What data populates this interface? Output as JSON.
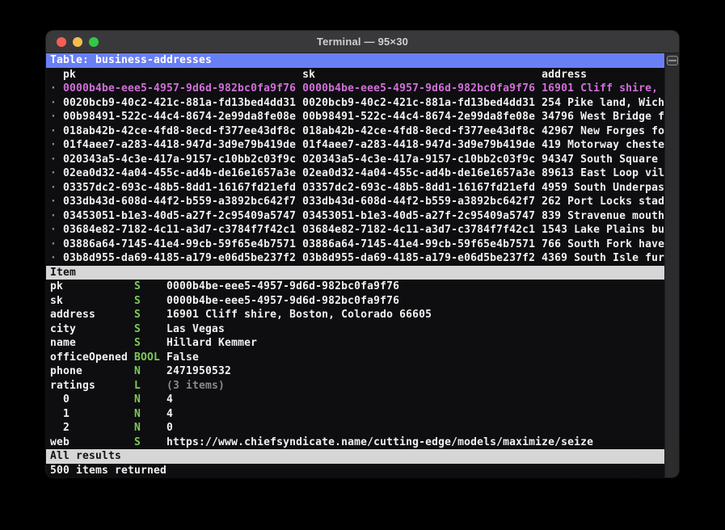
{
  "window": {
    "title": "Terminal — 95×30"
  },
  "colors": {
    "accent_blue": "#6980f5",
    "selected_magenta": "#d06fd8",
    "type_green": "#7ccb54",
    "bar_gray": "#d6d6d6",
    "term_bg": "#0e0e10",
    "titlebar_bg": "#39393b",
    "fg": "#f1f1f1",
    "dim": "#8a8a8a",
    "bullet": "#8f8f8f",
    "scroll_bg": "#2c2c2e",
    "tl_red": "#f35f56",
    "tl_yellow": "#f5bd4f",
    "tl_green": "#33c748"
  },
  "table": {
    "title": "Table: business-addresses",
    "columns": [
      "pk",
      "sk",
      "address"
    ],
    "rows": [
      {
        "pk": "0000b4be-eee5-4957-9d6d-982bc0fa9f76",
        "sk": "0000b4be-eee5-4957-9d6d-982bc0fa9f76",
        "address": "16901 Cliff shire,",
        "selected": true
      },
      {
        "pk": "0020bcb9-40c2-421c-881a-fd13bed4dd31",
        "sk": "0020bcb9-40c2-421c-881a-fd13bed4dd31",
        "address": "254 Pike land, Wich",
        "selected": false
      },
      {
        "pk": "00b98491-522c-44c4-8674-2e99da8fe08e",
        "sk": "00b98491-522c-44c4-8674-2e99da8fe08e",
        "address": "34796 West Bridge f",
        "selected": false
      },
      {
        "pk": "018ab42b-42ce-4fd8-8ecd-f377ee43df8c",
        "sk": "018ab42b-42ce-4fd8-8ecd-f377ee43df8c",
        "address": "42967 New Forges fo",
        "selected": false
      },
      {
        "pk": "01f4aee7-a283-4418-947d-3d9e79b419de",
        "sk": "01f4aee7-a283-4418-947d-3d9e79b419de",
        "address": "419 Motorway cheste",
        "selected": false
      },
      {
        "pk": "020343a5-4c3e-417a-9157-c10bb2c03f9c",
        "sk": "020343a5-4c3e-417a-9157-c10bb2c03f9c",
        "address": "94347 South Square",
        "selected": false
      },
      {
        "pk": "02ea0d32-4a04-455c-ad4b-de16e1657a3e",
        "sk": "02ea0d32-4a04-455c-ad4b-de16e1657a3e",
        "address": "89613 East Loop vil",
        "selected": false
      },
      {
        "pk": "03357dc2-693c-48b5-8dd1-16167fd21efd",
        "sk": "03357dc2-693c-48b5-8dd1-16167fd21efd",
        "address": "4959 South Underpas",
        "selected": false
      },
      {
        "pk": "033db43d-608d-44f2-b559-a3892bc642f7",
        "sk": "033db43d-608d-44f2-b559-a3892bc642f7",
        "address": "262 Port Locks stad",
        "selected": false
      },
      {
        "pk": "03453051-b1e3-40d5-a27f-2c95409a5747",
        "sk": "03453051-b1e3-40d5-a27f-2c95409a5747",
        "address": "839 Stravenue mouth",
        "selected": false
      },
      {
        "pk": "03684e82-7182-4c11-a3d7-c3784f7f42c1",
        "sk": "03684e82-7182-4c11-a3d7-c3784f7f42c1",
        "address": "1543 Lake Plains bu",
        "selected": false
      },
      {
        "pk": "03886a64-7145-41e4-99cb-59f65e4b7571",
        "sk": "03886a64-7145-41e4-99cb-59f65e4b7571",
        "address": "766 South Fork have",
        "selected": false
      },
      {
        "pk": "03b8d955-da69-4185-a179-e06d5be237f2",
        "sk": "03b8d955-da69-4185-a179-e06d5be237f2",
        "address": "4369 South Isle fur",
        "selected": false
      }
    ]
  },
  "item": {
    "header": "Item",
    "fields": [
      {
        "key": "pk",
        "type": "S",
        "value": "0000b4be-eee5-4957-9d6d-982bc0fa9f76",
        "dim": false
      },
      {
        "key": "sk",
        "type": "S",
        "value": "0000b4be-eee5-4957-9d6d-982bc0fa9f76",
        "dim": false
      },
      {
        "key": "address",
        "type": "S",
        "value": "16901 Cliff shire, Boston, Colorado 66605",
        "dim": false
      },
      {
        "key": "city",
        "type": "S",
        "value": "Las Vegas",
        "dim": false
      },
      {
        "key": "name",
        "type": "S",
        "value": "Hillard Kemmer",
        "dim": false
      },
      {
        "key": "officeOpened",
        "type": "BOOL",
        "value": "False",
        "dim": false
      },
      {
        "key": "phone",
        "type": "N",
        "value": "2471950532",
        "dim": false
      },
      {
        "key": "ratings",
        "type": "L",
        "value": "(3 items)",
        "dim": true
      },
      {
        "key": "  0",
        "type": "N",
        "value": "4",
        "dim": false
      },
      {
        "key": "  1",
        "type": "N",
        "value": "4",
        "dim": false
      },
      {
        "key": "  2",
        "type": "N",
        "value": "0",
        "dim": false
      },
      {
        "key": "web",
        "type": "S",
        "value": "https://www.chiefsyndicate.name/cutting-edge/models/maximize/seize",
        "dim": false
      }
    ]
  },
  "status": {
    "filter": "All results",
    "count": "500 items returned"
  }
}
